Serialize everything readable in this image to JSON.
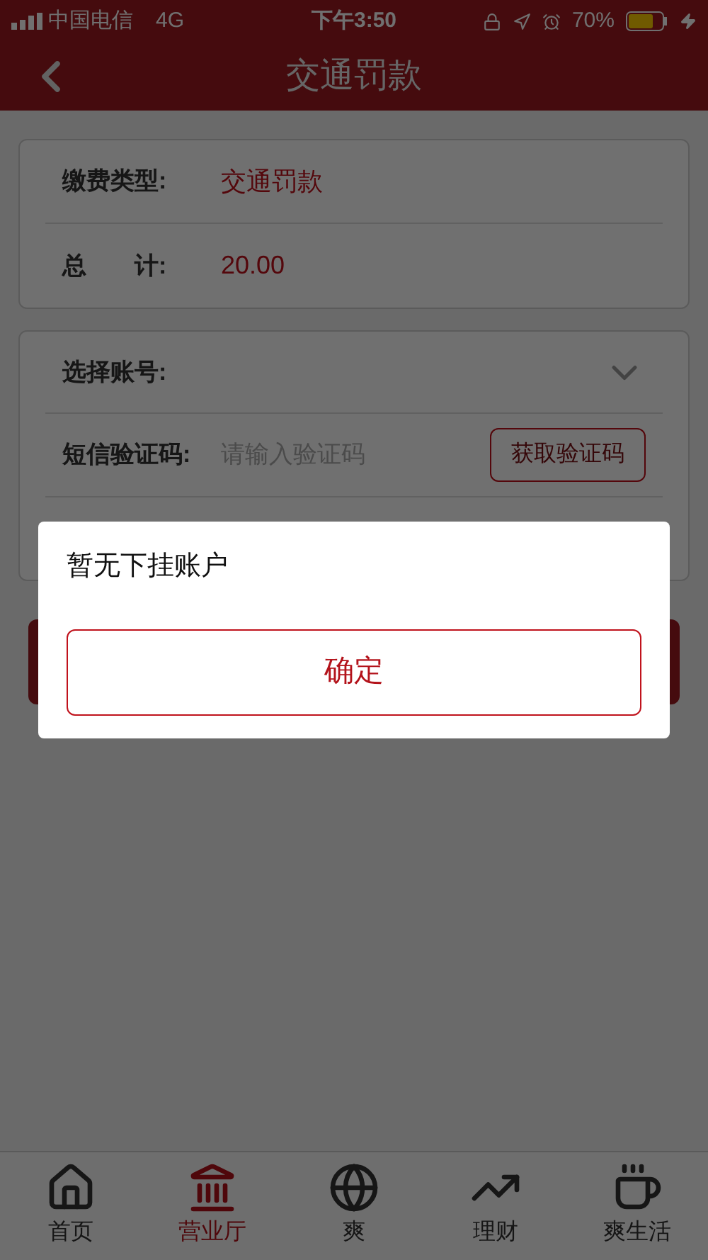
{
  "status_bar": {
    "carrier": "中国电信",
    "network": "4G",
    "time": "下午3:50",
    "battery": "70%"
  },
  "nav": {
    "title": "交通罚款"
  },
  "summary": [
    {
      "label": "缴费类型:",
      "value": "交通罚款"
    },
    {
      "label": "总　　计:",
      "value": "20.00"
    }
  ],
  "form": {
    "account_label": "选择账号:",
    "sms_label": "短信验证码:",
    "sms_placeholder": "请输入验证码",
    "sms_button": "获取验证码"
  },
  "dialog": {
    "message": "暂无下挂账户",
    "button": "确定"
  },
  "tab_bar": [
    {
      "label": "首页",
      "selected": false
    },
    {
      "label": "营业厅",
      "selected": true
    },
    {
      "label": "爽",
      "selected": false
    },
    {
      "label": "理财",
      "selected": false
    },
    {
      "label": "爽生活",
      "selected": false
    }
  ]
}
